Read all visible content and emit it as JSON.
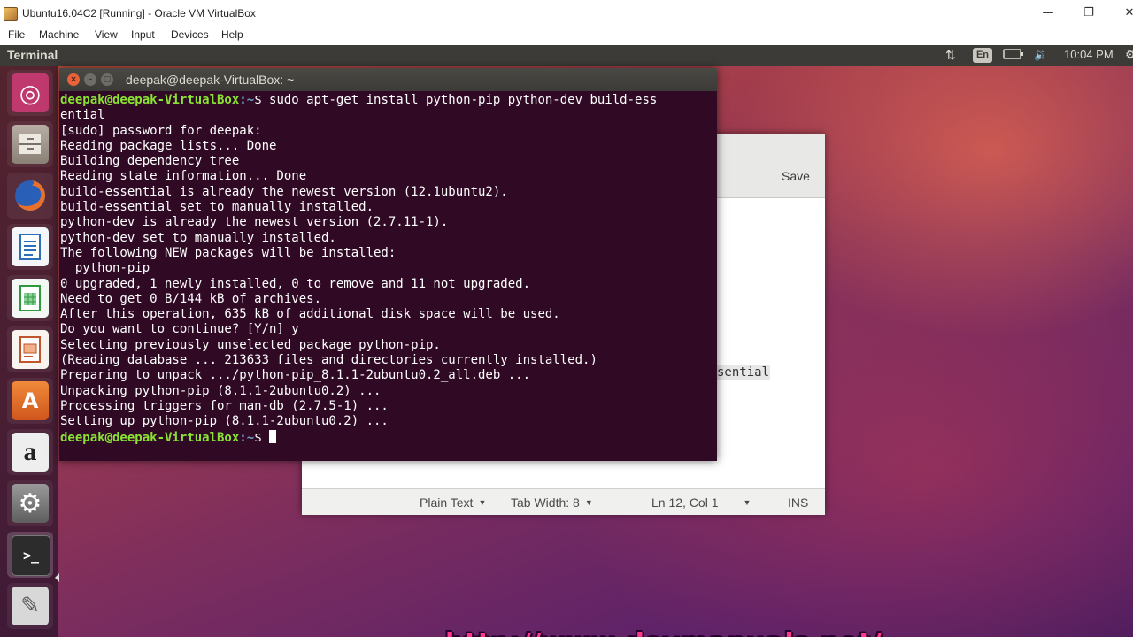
{
  "host_window": {
    "title": "Ubuntu16.04C2 [Running] - Oracle VM VirtualBox",
    "controls": {
      "minimize": "—",
      "maximize": "❐",
      "close": "✕"
    },
    "menu": [
      "File",
      "Machine",
      "View",
      "Input",
      "Devices",
      "Help"
    ]
  },
  "top_panel": {
    "app_title": "Terminal",
    "indicators": {
      "network_icon": "network-arrows-icon",
      "language": "En",
      "battery_icon": "battery-icon",
      "volume_icon": "volume-icon",
      "time": "10:04 PM",
      "power_icon": "power-icon"
    }
  },
  "launcher": {
    "items": [
      {
        "name": "ubuntu-dash",
        "icon": "ubuntu-logo-icon",
        "color": "#c0396e"
      },
      {
        "name": "files",
        "icon": "file-cabinet-icon",
        "color": "#9a8f84"
      },
      {
        "name": "firefox",
        "icon": "firefox-icon",
        "color": "#e8702a"
      },
      {
        "name": "libreoffice-writer",
        "icon": "writer-icon",
        "color": "#2a6fb7"
      },
      {
        "name": "libreoffice-calc",
        "icon": "calc-icon",
        "color": "#2e9a3e"
      },
      {
        "name": "libreoffice-impress",
        "icon": "impress-icon",
        "color": "#c2532a"
      },
      {
        "name": "software-center",
        "icon": "shopping-bag-icon",
        "color": "#e06a22"
      },
      {
        "name": "amazon",
        "icon": "amazon-icon",
        "color": "#e9e9e9"
      },
      {
        "name": "system-settings",
        "icon": "settings-icon",
        "color": "#8a8a8a"
      },
      {
        "name": "terminal",
        "icon": "terminal-icon",
        "color": "#2c2c2c"
      },
      {
        "name": "text-editor",
        "icon": "text-editor-icon",
        "color": "#d8d8d8"
      }
    ],
    "glyphs": {
      "ubuntu-dash": "◎",
      "files": "",
      "firefox": "",
      "libreoffice-writer": "",
      "libreoffice-calc": "",
      "libreoffice-impress": "",
      "software-center": "A",
      "amazon": "a",
      "system-settings": "⚙",
      "terminal": ">_",
      "text-editor": "✎"
    }
  },
  "gedit": {
    "save_label": "Save",
    "visible_text_fragment": "sential",
    "status": {
      "language": "Plain Text",
      "tab_width": "Tab Width: 8",
      "position": "Ln 12, Col 1",
      "mode": "INS"
    }
  },
  "terminal": {
    "title": "deepak@deepak-VirtualBox: ~",
    "prompt_user": "deepak@deepak-VirtualBox",
    "prompt_path": ":~",
    "prompt_symbol": "$ ",
    "command": "sudo apt-get install python-pip python-dev build-essential",
    "output": [
      "[sudo] password for deepak:",
      "Reading package lists... Done",
      "Building dependency tree",
      "Reading state information... Done",
      "build-essential is already the newest version (12.1ubuntu2).",
      "build-essential set to manually installed.",
      "python-dev is already the newest version (2.7.11-1).",
      "python-dev set to manually installed.",
      "The following NEW packages will be installed:",
      "  python-pip",
      "0 upgraded, 1 newly installed, 0 to remove and 11 not upgraded.",
      "Need to get 0 B/144 kB of archives.",
      "After this operation, 635 kB of additional disk space will be used.",
      "Do you want to continue? [Y/n] y",
      "Selecting previously unselected package python-pip.",
      "(Reading database ... 213633 files and directories currently installed.)",
      "Preparing to unpack .../python-pip_8.1.1-2ubuntu0.2_all.deb ...",
      "Unpacking python-pip (8.1.1-2ubuntu0.2) ...",
      "Processing triggers for man-db (2.7.5-1) ...",
      "Setting up python-pip (8.1.1-2ubuntu0.2) ..."
    ]
  },
  "watermark": "http://www.devmanuals.net/"
}
